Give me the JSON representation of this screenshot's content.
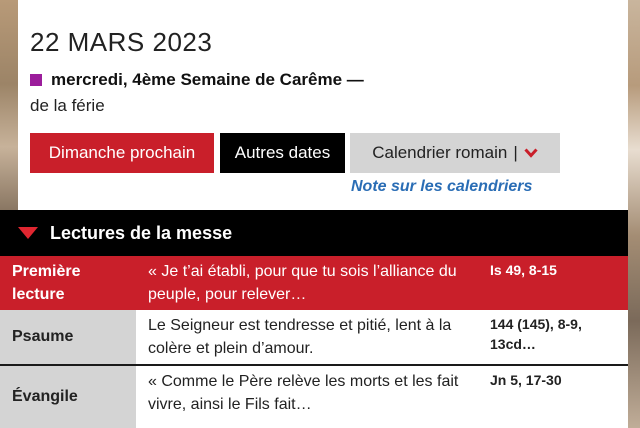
{
  "date": "22 MARS 2023",
  "day": {
    "title": "mercredi, 4ème Semaine de Carême —",
    "subtitle": "de la férie",
    "liturgical_color": "#9b1d9b"
  },
  "buttons": {
    "next_sunday": "Dimanche prochain",
    "other_dates": "Autres dates",
    "calendar": "Calendrier romain",
    "calendar_separator": "|"
  },
  "note_link": "Note sur les calendriers",
  "readings": {
    "header": "Lectures de la messe",
    "items": [
      {
        "label": "Première lecture",
        "text": "« Je t’ai établi, pour que tu sois l’alliance du peuple, pour relever…",
        "ref": "Is 49, 8-15"
      },
      {
        "label": "Psaume",
        "text": "Le Seigneur est tendresse et pitié, lent à la colère et plein d’amour.",
        "ref": "144 (145), 8-9, 13cd…"
      },
      {
        "label": "Évangile",
        "text": "« Comme le Père relève les morts et les fait vivre, ainsi le Fils fait…",
        "ref": "Jn 5, 17-30"
      }
    ]
  },
  "colors": {
    "accent_red": "#c91f2a",
    "link_blue": "#2a6db5"
  }
}
